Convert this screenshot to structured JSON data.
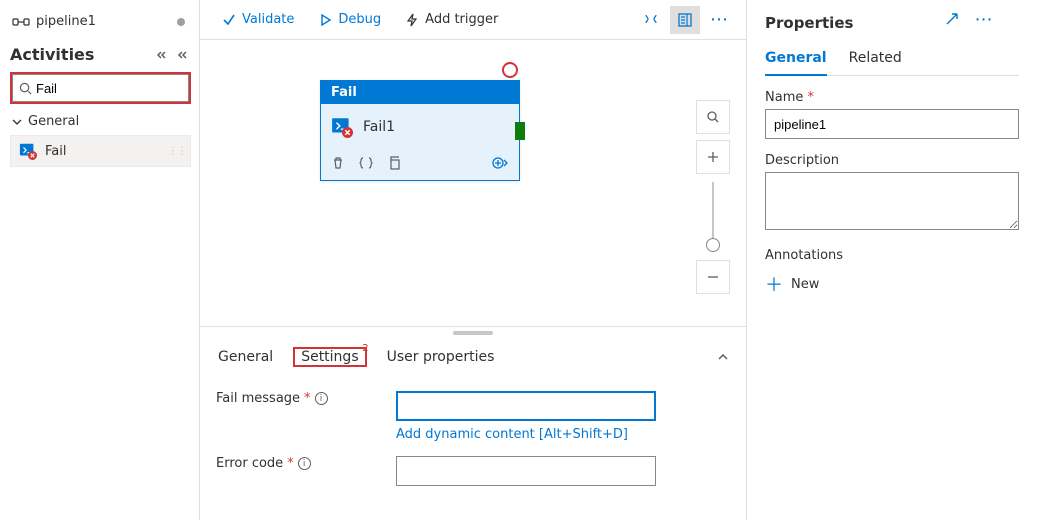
{
  "tab": {
    "title": "pipeline1"
  },
  "activities": {
    "heading": "Activities",
    "search_value": "Fail",
    "category": "General",
    "item": "Fail"
  },
  "toolbar": {
    "validate": "Validate",
    "debug": "Debug",
    "add_trigger": "Add trigger"
  },
  "node": {
    "type_label": "Fail",
    "name": "Fail1"
  },
  "details": {
    "tab_general": "General",
    "tab_settings": "Settings",
    "tab_settings_badge": "2",
    "tab_user_props": "User properties",
    "fail_message_label": "Fail message",
    "fail_message_value": "",
    "dyn_link": "Add dynamic content [Alt+Shift+D]",
    "error_code_label": "Error code",
    "error_code_value": ""
  },
  "props": {
    "title": "Properties",
    "tab_general": "General",
    "tab_related": "Related",
    "name_label": "Name",
    "name_value": "pipeline1",
    "desc_label": "Description",
    "desc_value": "",
    "ann_label": "Annotations",
    "ann_new": "New"
  }
}
